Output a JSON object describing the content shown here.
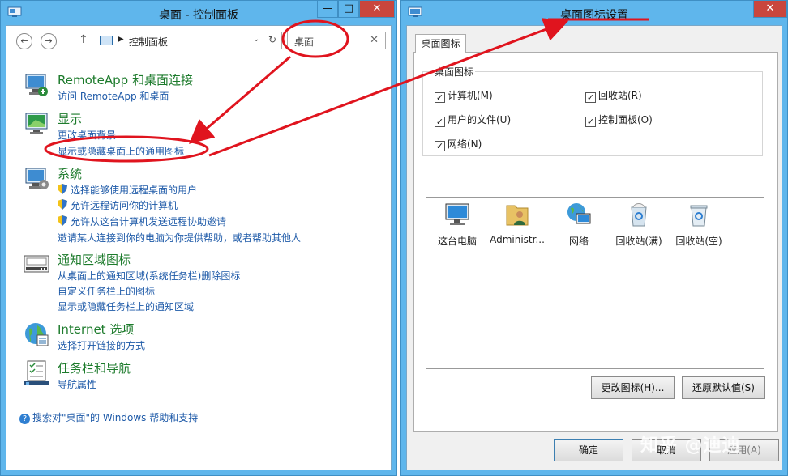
{
  "control_panel": {
    "title": "桌面 - 控制面板",
    "address": "控制面板",
    "search_query": "桌面",
    "categories": [
      {
        "heading": "RemoteApp 和桌面连接",
        "links": [
          "访问 RemoteApp 和桌面"
        ]
      },
      {
        "heading": "显示",
        "links": [
          "更改桌面背景",
          "显示或隐藏桌面上的通用图标"
        ]
      },
      {
        "heading": "系统",
        "links": [
          "选择能够使用远程桌面的用户",
          "允许远程访问你的计算机",
          "允许从这台计算机发送远程协助邀请",
          "邀请某人连接到你的电脑为你提供帮助，或者帮助其他人"
        ]
      },
      {
        "heading": "通知区域图标",
        "links": [
          "从桌面上的通知区域(系统任务栏)删除图标",
          "自定义任务栏上的图标",
          "显示或隐藏任务栏上的通知区域"
        ]
      },
      {
        "heading": "Internet 选项",
        "links": [
          "选择打开链接的方式"
        ]
      },
      {
        "heading": "任务栏和导航",
        "links": [
          "导航属性"
        ]
      }
    ],
    "help_text": "搜索对\"桌面\"的 Windows 帮助和支持"
  },
  "dialog": {
    "title": "桌面图标设置",
    "tab": "桌面图标",
    "group_label": "桌面图标",
    "checkboxes": [
      {
        "label": "计算机(M)",
        "checked": true
      },
      {
        "label": "回收站(R)",
        "checked": true
      },
      {
        "label": "用户的文件(U)",
        "checked": true
      },
      {
        "label": "控制面板(O)",
        "checked": true
      },
      {
        "label": "网络(N)",
        "checked": true
      }
    ],
    "icons": [
      "这台电脑",
      "Administr...",
      "网络",
      "回收站(满)",
      "回收站(空)"
    ],
    "change_icon_button": "更改图标(H)...",
    "restore_default_button": "还原默认值(S)",
    "ok_button": "确定",
    "cancel_button": "取消",
    "apply_button": "应用(A)"
  },
  "caption_buttons": {
    "minimize": "—",
    "maximize": "□",
    "close": "✕"
  },
  "watermark": "知乎 @迪迪",
  "colors": {
    "frame": "#5fb6ec",
    "heading_green": "#1d7b2c",
    "link_blue": "#1e5aa8",
    "annotation_red": "#e0141e"
  }
}
